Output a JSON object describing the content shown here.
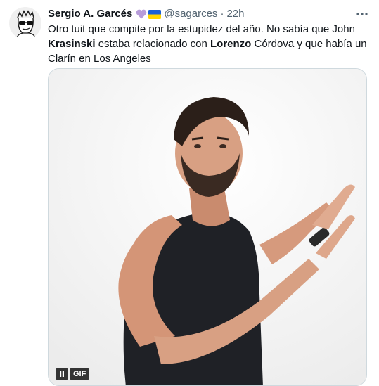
{
  "tweet": {
    "author_name": "Sergio A. Garcés",
    "author_handle": "@sagarces",
    "separator": "·",
    "timestamp": "22h",
    "text": [
      {
        "text": "Otro tuit que compite por la estupidez del año. No sabía que John ",
        "bold": false
      },
      {
        "text": "Krasinski",
        "bold": true
      },
      {
        "text": " estaba relacionado con ",
        "bold": false
      },
      {
        "text": "Lorenzo",
        "bold": true
      },
      {
        "text": " Córdova y que había un Clarín en Los Angeles",
        "bold": false
      }
    ],
    "badges": [
      "purple-heart-icon",
      "ukraine-flag-icon"
    ],
    "media": {
      "type": "gif",
      "badge_label": "GIF"
    }
  },
  "colors": {
    "text_primary": "#0f1419",
    "text_secondary": "#536471",
    "border": "#cfd9de",
    "heart": "#b79cd9",
    "flag_blue": "#1a5fd6",
    "flag_yellow": "#ffd500"
  }
}
